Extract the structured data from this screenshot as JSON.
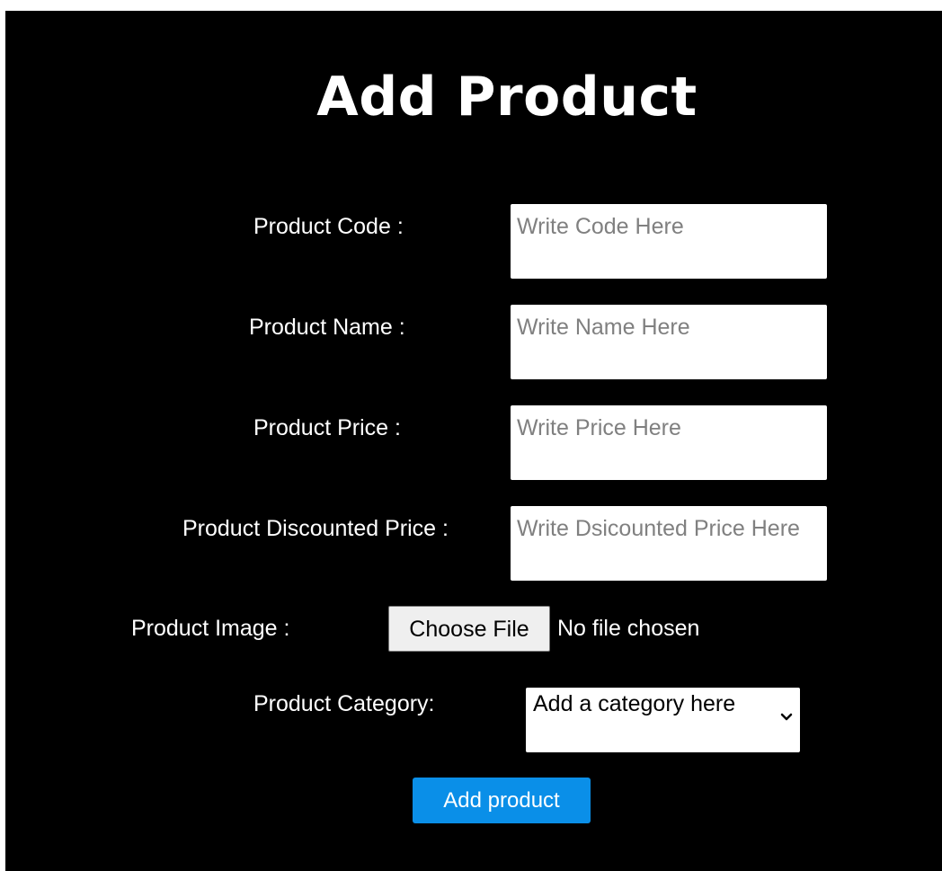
{
  "page": {
    "title": "Add Product"
  },
  "form": {
    "product_code": {
      "label": "Product Code :",
      "placeholder": "Write Code Here",
      "value": ""
    },
    "product_name": {
      "label": "Product Name :",
      "placeholder": "Write Name Here",
      "value": ""
    },
    "product_price": {
      "label": "Product Price :",
      "placeholder": "Write Price Here",
      "value": ""
    },
    "product_discounted_price": {
      "label": "Product Discounted Price :",
      "placeholder": "Write Dsicounted Price Here",
      "value": ""
    },
    "product_image": {
      "label": "Product Image :",
      "button_label": "Choose File",
      "status": "No file chosen"
    },
    "product_category": {
      "label": "Product Category:",
      "selected": "Add a category here",
      "icon": "chevron-down-icon"
    },
    "submit": {
      "label": "Add product"
    }
  },
  "colors": {
    "background": "#000000",
    "text": "#ffffff",
    "input_background": "#ffffff",
    "placeholder": "#808080",
    "file_button_background": "#efefef",
    "submit_background": "#0a8fe8"
  }
}
